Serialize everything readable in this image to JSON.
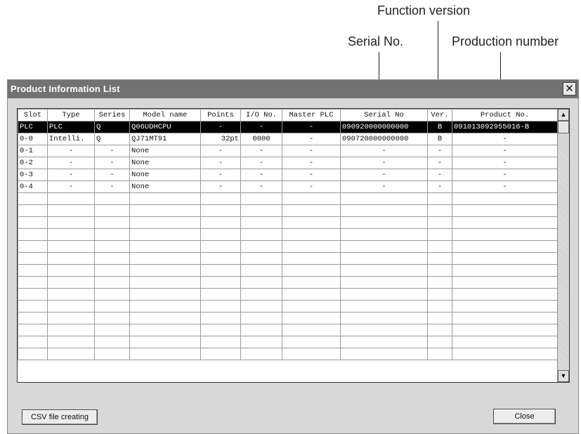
{
  "callouts": {
    "function_version": "Function version",
    "serial_no": "Serial No.",
    "production_number": "Production number"
  },
  "window": {
    "title": "Product Information List",
    "close_glyph": "✕"
  },
  "table": {
    "headers": [
      "Slot",
      "Type",
      "Series",
      "Model name",
      "Points",
      "I/O No.",
      "Master PLC",
      "Serial No",
      "Ver.",
      "Product No."
    ],
    "rows": [
      {
        "slot": "PLC",
        "type": "PLC",
        "series": "Q",
        "model": "Q06UDHCPU",
        "points": "-",
        "io": "-",
        "master": "-",
        "serial": "090920000000000",
        "ver": "B",
        "product": "091013092955016-B",
        "selected": true
      },
      {
        "slot": "0-0",
        "type": "Intelli.",
        "series": "Q",
        "model": "QJ71MT91",
        "points": "32pt",
        "io": "0000",
        "master": "-",
        "serial": "090720000000000",
        "ver": "B",
        "product": "-",
        "selected": false
      },
      {
        "slot": "0-1",
        "type": "-",
        "series": "-",
        "model": "None",
        "points": "-",
        "io": "-",
        "master": "-",
        "serial": "-",
        "ver": "-",
        "product": "-",
        "selected": false
      },
      {
        "slot": "0-2",
        "type": "-",
        "series": "-",
        "model": "None",
        "points": "-",
        "io": "-",
        "master": "-",
        "serial": "-",
        "ver": "-",
        "product": "-",
        "selected": false
      },
      {
        "slot": "0-3",
        "type": "-",
        "series": "-",
        "model": "None",
        "points": "-",
        "io": "-",
        "master": "-",
        "serial": "-",
        "ver": "-",
        "product": "-",
        "selected": false
      },
      {
        "slot": "0-4",
        "type": "-",
        "series": "-",
        "model": "None",
        "points": "-",
        "io": "-",
        "master": "-",
        "serial": "-",
        "ver": "-",
        "product": "-",
        "selected": false
      }
    ],
    "empty_rows": 14
  },
  "scrollbar": {
    "up_glyph": "▲",
    "down_glyph": "▼"
  },
  "buttons": {
    "csv_label": "CSV file creating",
    "close_label": "Close"
  }
}
